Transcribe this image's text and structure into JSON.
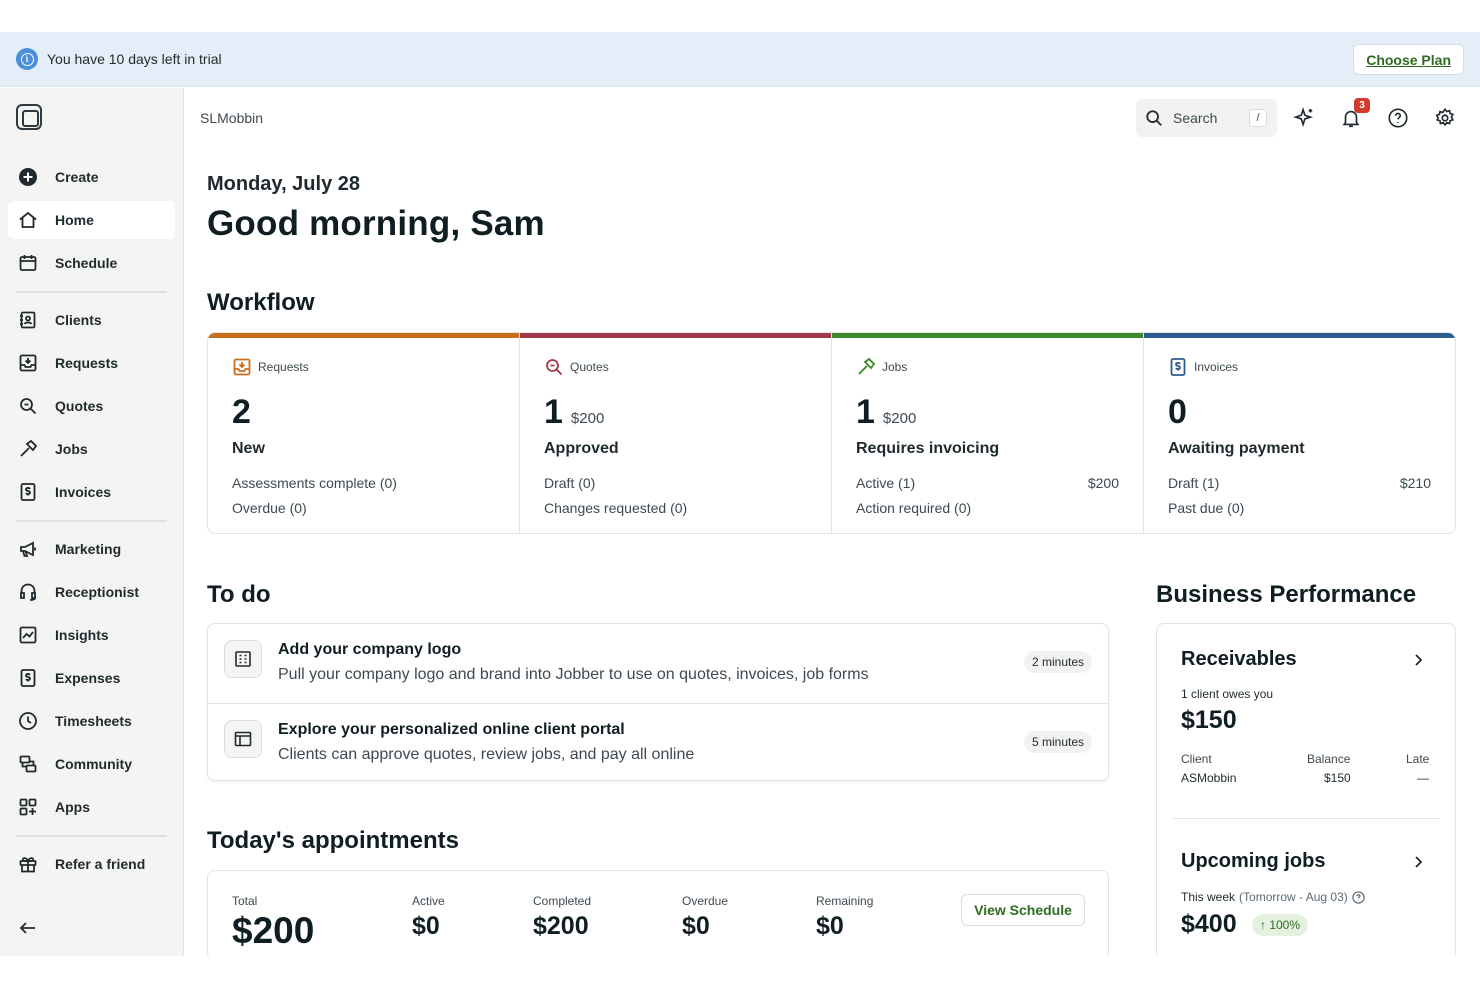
{
  "trial": {
    "message": "You have 10 days left in trial",
    "cta": "Choose Plan"
  },
  "sidebar": {
    "items": [
      {
        "label": "Create",
        "icon": "plus-circle-icon"
      },
      {
        "label": "Home",
        "icon": "home-icon"
      },
      {
        "label": "Schedule",
        "icon": "calendar-icon"
      },
      {
        "label": "Clients",
        "icon": "contacts-icon"
      },
      {
        "label": "Requests",
        "icon": "inbox-icon"
      },
      {
        "label": "Quotes",
        "icon": "quote-icon"
      },
      {
        "label": "Jobs",
        "icon": "hammer-icon"
      },
      {
        "label": "Invoices",
        "icon": "invoice-icon"
      },
      {
        "label": "Marketing",
        "icon": "megaphone-icon"
      },
      {
        "label": "Receptionist",
        "icon": "headset-icon"
      },
      {
        "label": "Insights",
        "icon": "chart-icon"
      },
      {
        "label": "Expenses",
        "icon": "receipt-icon"
      },
      {
        "label": "Timesheets",
        "icon": "clock-icon"
      },
      {
        "label": "Community",
        "icon": "community-icon"
      },
      {
        "label": "Apps",
        "icon": "apps-icon"
      },
      {
        "label": "Refer a friend",
        "icon": "gift-icon"
      }
    ],
    "collapse": "←"
  },
  "header": {
    "company": "SLMobbin",
    "search_label": "Search",
    "search_shortcut": "/",
    "notifications": "3"
  },
  "greeting": {
    "date": "Monday, July 28",
    "title": "Good morning, Sam"
  },
  "workflow": {
    "title": "Workflow",
    "colors": [
      "#c8701e",
      "#a3384a",
      "#3d8a2a",
      "#2c5d8f"
    ],
    "columns": [
      {
        "name": "Requests",
        "count": "2",
        "amount": "",
        "status": "New",
        "rows": [
          {
            "label": "Assessments complete (0)",
            "value": ""
          },
          {
            "label": "Overdue (0)",
            "value": ""
          }
        ]
      },
      {
        "name": "Quotes",
        "count": "1",
        "amount": "$200",
        "status": "Approved",
        "rows": [
          {
            "label": "Draft (0)",
            "value": ""
          },
          {
            "label": "Changes requested (0)",
            "value": ""
          }
        ]
      },
      {
        "name": "Jobs",
        "count": "1",
        "amount": "$200",
        "status": "Requires invoicing",
        "rows": [
          {
            "label": "Active (1)",
            "value": "$200"
          },
          {
            "label": "Action required (0)",
            "value": ""
          }
        ]
      },
      {
        "name": "Invoices",
        "count": "0",
        "amount": "",
        "status": "Awaiting payment",
        "rows": [
          {
            "label": "Draft (1)",
            "value": "$210"
          },
          {
            "label": "Past due (0)",
            "value": ""
          }
        ]
      }
    ]
  },
  "todo": {
    "title": "To do",
    "items": [
      {
        "title": "Add your company logo",
        "desc": "Pull your company logo and brand into Jobber to use on quotes, invoices, job forms",
        "time": "2 minutes"
      },
      {
        "title": "Explore your personalized online client portal",
        "desc": "Clients can approve quotes, review jobs, and pay all online",
        "time": "5 minutes"
      }
    ]
  },
  "appointments": {
    "title": "Today's appointments",
    "stats": [
      {
        "label": "Total",
        "value": "$200"
      },
      {
        "label": "Active",
        "value": "$0"
      },
      {
        "label": "Completed",
        "value": "$200"
      },
      {
        "label": "Overdue",
        "value": "$0"
      },
      {
        "label": "Remaining",
        "value": "$0"
      }
    ],
    "cta": "View Schedule"
  },
  "performance": {
    "title": "Business Performance",
    "receivables": {
      "title": "Receivables",
      "subtitle": "1 client owes you",
      "amount": "$150",
      "headers": [
        "Client",
        "Balance",
        "Late"
      ],
      "row": [
        "ASMobbin",
        "$150",
        "—"
      ]
    },
    "upcoming": {
      "title": "Upcoming jobs",
      "period": "This week",
      "range": "(Tomorrow - Aug 03)",
      "amount": "$400",
      "growth": "↑ 100%"
    }
  }
}
